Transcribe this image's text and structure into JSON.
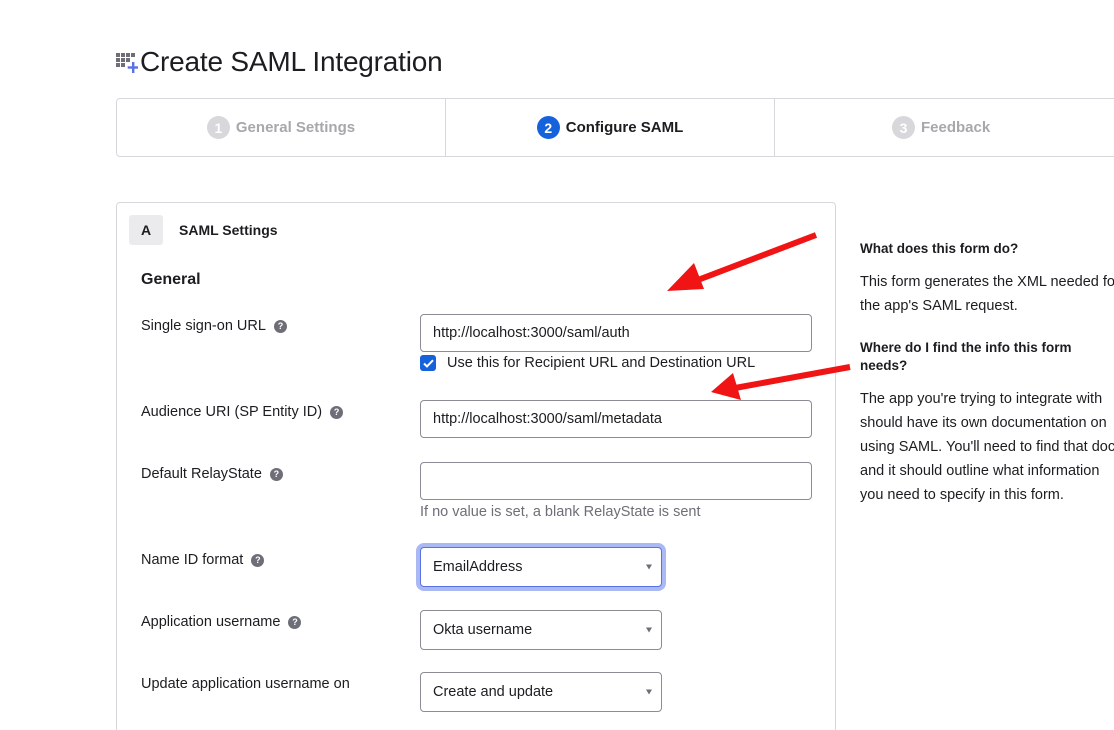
{
  "header": {
    "title": "Create SAML Integration",
    "icon": "apps-add-icon",
    "icon_color": "#5a72e6"
  },
  "stepper": {
    "steps": [
      {
        "number": "1",
        "label": "General Settings",
        "state": "inactive"
      },
      {
        "number": "2",
        "label": "Configure SAML",
        "state": "active"
      },
      {
        "number": "3",
        "label": "Feedback",
        "state": "inactive"
      }
    ],
    "active_color": "#1662dd"
  },
  "card": {
    "section_badge": "A",
    "section_title": "SAML Settings",
    "group_title": "General",
    "sso_url": {
      "label": "Single sign-on URL",
      "value": "http://localhost:3000/saml/auth",
      "checkbox_label": "Use this for Recipient URL and Destination URL",
      "checked": true
    },
    "audience_uri": {
      "label": "Audience URI (SP Entity ID)",
      "value": "http://localhost:3000/saml/metadata"
    },
    "relay_state": {
      "label": "Default RelayState",
      "value": "",
      "hint": "If no value is set, a blank RelayState is sent"
    },
    "name_id_format": {
      "label": "Name ID format",
      "value": "EmailAddress"
    },
    "app_username": {
      "label": "Application username",
      "value": "Okta username"
    },
    "update_username": {
      "label": "Update application username on",
      "value": "Create and update"
    }
  },
  "aside": {
    "q1": "What does this form do?",
    "a1": "This form generates the XML needed for the app's SAML request.",
    "q2": "Where do I find the info this form needs?",
    "a2": "The app you're trying to integrate with should have its own documentation on using SAML. You'll need to find that doc, and it should outline what information you need to specify in this form."
  },
  "annotations": {
    "arrow_color": "#f01414"
  }
}
